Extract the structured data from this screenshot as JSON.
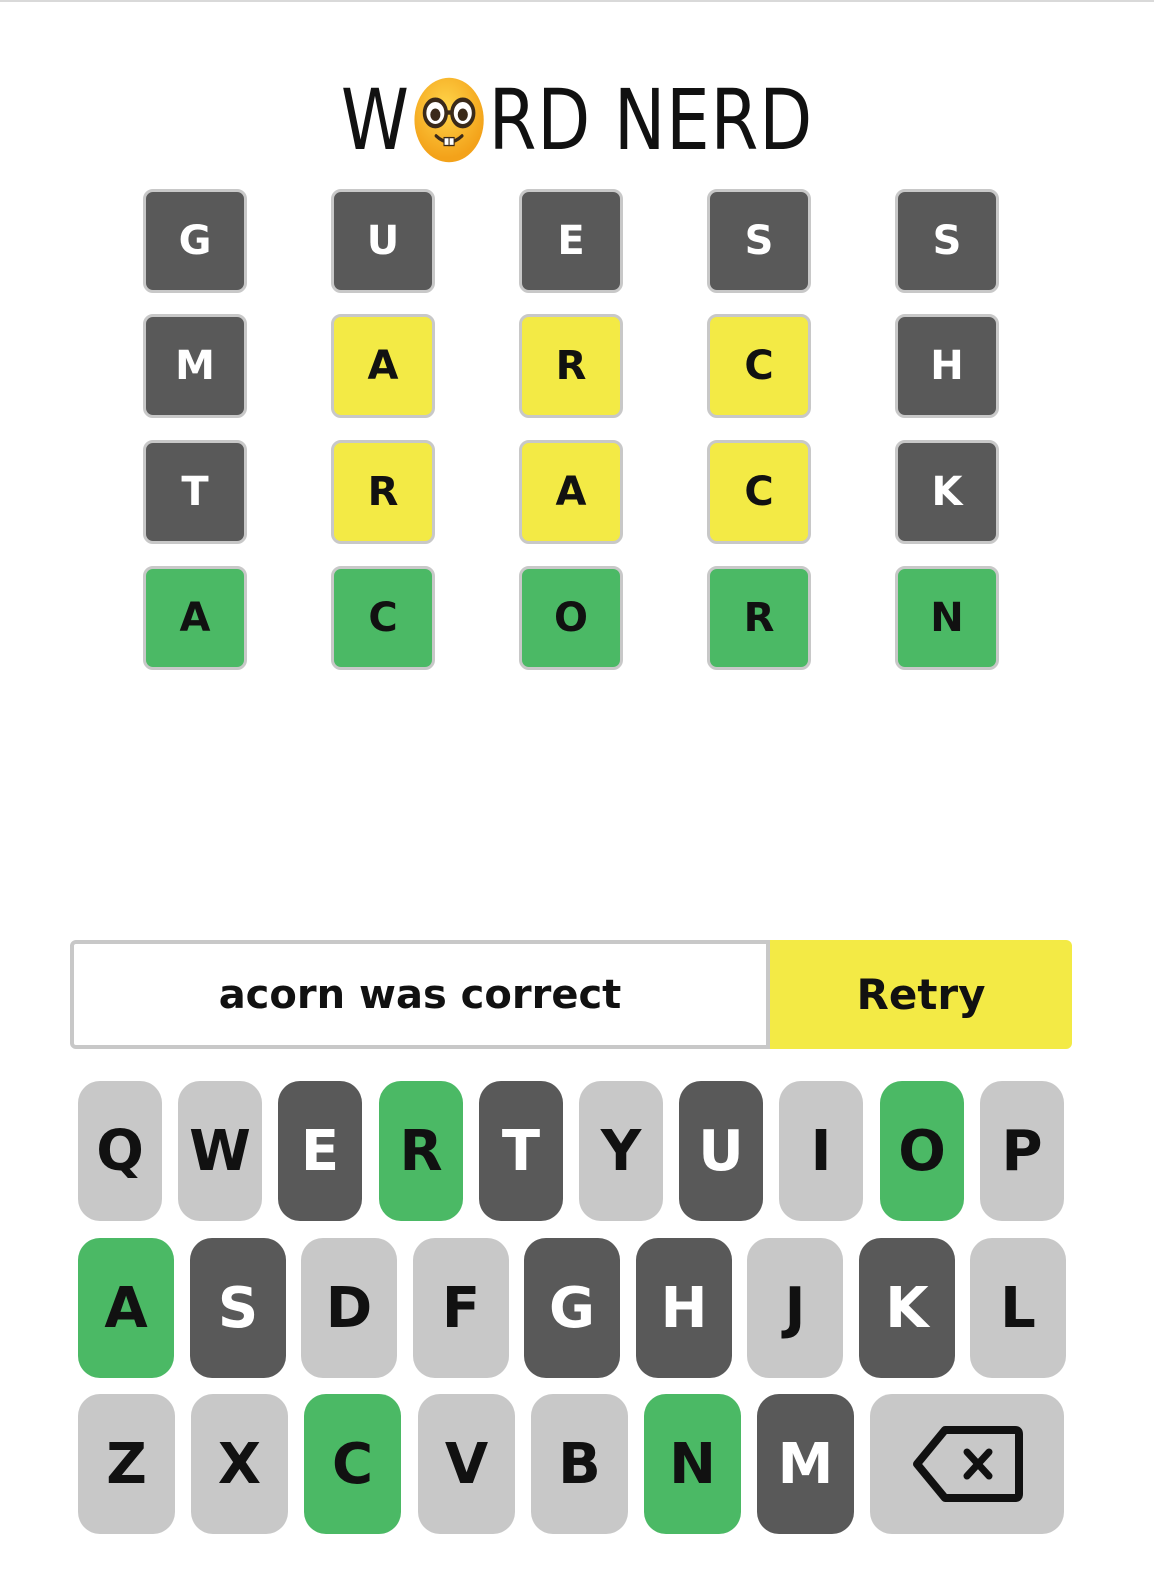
{
  "title": {
    "before": "W",
    "emoji_name": "nerd-face-emoji",
    "after": "RD NERD"
  },
  "board": {
    "rows": [
      [
        {
          "letter": "G",
          "state": "absent"
        },
        {
          "letter": "U",
          "state": "absent"
        },
        {
          "letter": "E",
          "state": "absent"
        },
        {
          "letter": "S",
          "state": "absent"
        },
        {
          "letter": "S",
          "state": "absent"
        }
      ],
      [
        {
          "letter": "M",
          "state": "absent"
        },
        {
          "letter": "A",
          "state": "present"
        },
        {
          "letter": "R",
          "state": "present"
        },
        {
          "letter": "C",
          "state": "present"
        },
        {
          "letter": "H",
          "state": "absent"
        }
      ],
      [
        {
          "letter": "T",
          "state": "absent"
        },
        {
          "letter": "R",
          "state": "present"
        },
        {
          "letter": "A",
          "state": "present"
        },
        {
          "letter": "C",
          "state": "present"
        },
        {
          "letter": "K",
          "state": "absent"
        }
      ],
      [
        {
          "letter": "A",
          "state": "correct"
        },
        {
          "letter": "C",
          "state": "correct"
        },
        {
          "letter": "O",
          "state": "correct"
        },
        {
          "letter": "R",
          "state": "correct"
        },
        {
          "letter": "N",
          "state": "correct"
        }
      ]
    ]
  },
  "message": {
    "text": "acorn was correct",
    "retry_label": "Retry"
  },
  "keyboard": {
    "rows": [
      [
        {
          "key": "Q",
          "state": "unused"
        },
        {
          "key": "W",
          "state": "unused"
        },
        {
          "key": "E",
          "state": "absent"
        },
        {
          "key": "R",
          "state": "correct"
        },
        {
          "key": "T",
          "state": "absent"
        },
        {
          "key": "Y",
          "state": "unused"
        },
        {
          "key": "U",
          "state": "absent"
        },
        {
          "key": "I",
          "state": "unused"
        },
        {
          "key": "O",
          "state": "correct"
        },
        {
          "key": "P",
          "state": "unused"
        }
      ],
      [
        {
          "key": "A",
          "state": "correct"
        },
        {
          "key": "S",
          "state": "absent"
        },
        {
          "key": "D",
          "state": "unused"
        },
        {
          "key": "F",
          "state": "unused"
        },
        {
          "key": "G",
          "state": "absent"
        },
        {
          "key": "H",
          "state": "absent"
        },
        {
          "key": "J",
          "state": "unused"
        },
        {
          "key": "K",
          "state": "absent"
        },
        {
          "key": "L",
          "state": "unused"
        }
      ],
      [
        {
          "key": "Z",
          "state": "unused"
        },
        {
          "key": "X",
          "state": "unused"
        },
        {
          "key": "C",
          "state": "correct"
        },
        {
          "key": "V",
          "state": "unused"
        },
        {
          "key": "B",
          "state": "unused"
        },
        {
          "key": "N",
          "state": "correct"
        },
        {
          "key": "M",
          "state": "absent"
        },
        {
          "key": "",
          "state": "unused",
          "icon": "backspace-icon"
        }
      ]
    ]
  },
  "colors": {
    "absent": "#595959",
    "present": "#f3ea45",
    "correct": "#4bb965",
    "unused": "#c8c8c8"
  }
}
